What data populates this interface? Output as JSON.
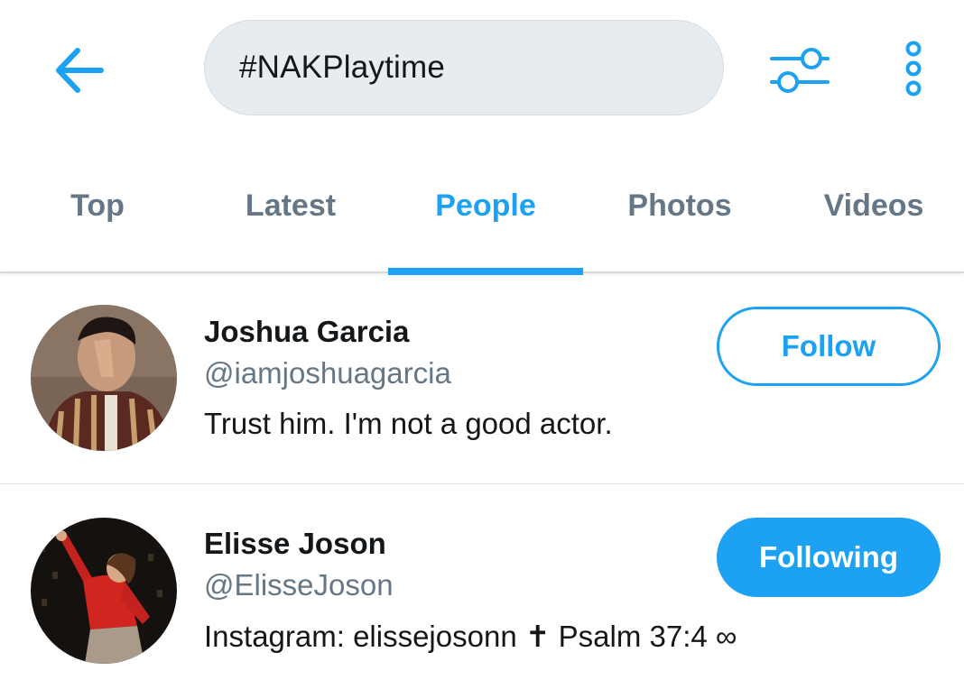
{
  "colors": {
    "accent": "#1da1f2",
    "muted": "#657786",
    "text": "#14171a",
    "search_bg": "#e6ecf0"
  },
  "header": {
    "back_icon": "arrow-left-icon",
    "search_query": "#NAKPlaytime",
    "filter_icon": "sliders-icon",
    "more_icon": "vertical-dots-icon"
  },
  "tabs": [
    {
      "label": "Top",
      "active": false
    },
    {
      "label": "Latest",
      "active": false
    },
    {
      "label": "People",
      "active": true
    },
    {
      "label": "Photos",
      "active": false
    },
    {
      "label": "Videos",
      "active": false
    }
  ],
  "users": [
    {
      "name": "Joshua Garcia",
      "handle": "@iamjoshuagarcia",
      "bio": "Trust him. I'm not a good actor.",
      "button": "Follow"
    },
    {
      "name": "Elisse Joson",
      "handle": "@ElisseJoson",
      "bio": "Instagram: elissejosonn ✝ Psalm 37:4 ∞",
      "button": "Following"
    }
  ]
}
